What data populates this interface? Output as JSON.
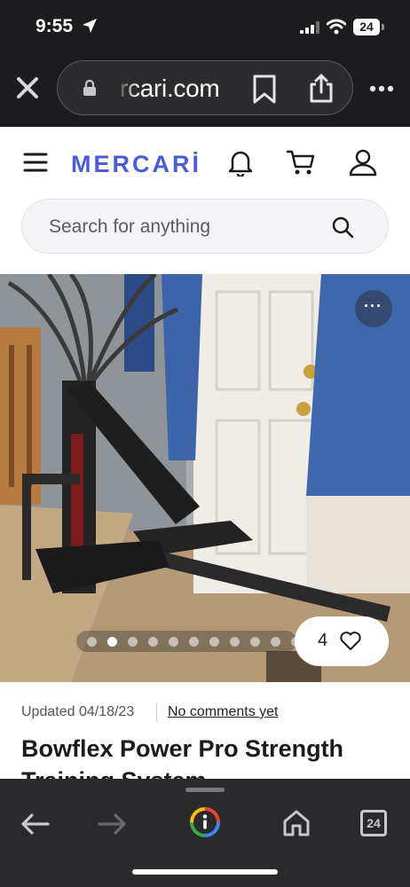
{
  "status_bar": {
    "time": "9:55",
    "battery": "24"
  },
  "browser": {
    "url": "rcari.com",
    "tab_count": "24"
  },
  "header": {
    "logo": "MERCARİ"
  },
  "search": {
    "placeholder": "Search for anything"
  },
  "photo": {
    "more_label": "···",
    "like_count": "4",
    "photo_count": 11,
    "active_index": 1
  },
  "listing": {
    "updated": "Updated 04/18/23",
    "comments_link": "No comments yet",
    "title": "Bowflex Power Pro Strength Training System"
  },
  "colors": {
    "brand": "#4c5bd9",
    "browser_chrome": "#1c1c1e"
  },
  "icons": [
    "location-arrow-icon",
    "signal-icon",
    "wifi-icon",
    "close-icon",
    "lock-icon",
    "bookmark-icon",
    "share-icon",
    "more-icon",
    "hamburger-icon",
    "bell-icon",
    "cart-icon",
    "user-icon",
    "search-icon",
    "heart-icon",
    "back-icon",
    "forward-icon",
    "google-icon",
    "home-icon",
    "tabs-icon"
  ]
}
